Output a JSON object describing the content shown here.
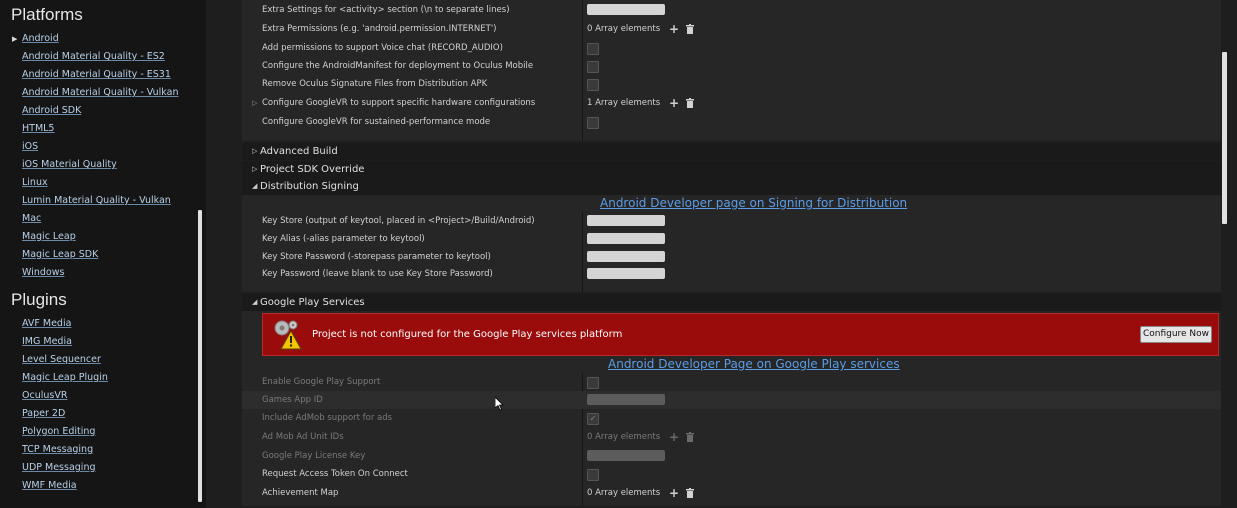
{
  "sidebar": {
    "platforms_title": "Platforms",
    "platforms": [
      "Android",
      "Android Material Quality - ES2",
      "Android Material Quality - ES31",
      "Android Material Quality - Vulkan",
      "Android SDK",
      "HTML5",
      "iOS",
      "iOS Material Quality",
      "Linux",
      "Lumin Material Quality - Vulkan",
      "Mac",
      "Magic Leap",
      "Magic Leap SDK",
      "Windows"
    ],
    "plugins_title": "Plugins",
    "plugins": [
      "AVF Media",
      "IMG Media",
      "Level Sequencer",
      "Magic Leap Plugin",
      "OculusVR",
      "Paper 2D",
      "Polygon Editing",
      "TCP Messaging",
      "UDP Messaging",
      "WMF Media"
    ]
  },
  "top_rows": {
    "extra_settings": "Extra Settings for <activity> section (\\n to separate lines)",
    "extra_permissions": "Extra Permissions (e.g. 'android.permission.INTERNET')",
    "extra_permissions_value": "0 Array elements",
    "voice_chat": "Add permissions to support Voice chat (RECORD_AUDIO)",
    "oculus_mobile": "Configure the AndroidManifest for deployment to Oculus Mobile",
    "remove_oculus": "Remove Oculus Signature Files from Distribution APK",
    "googlevr_hw": "Configure GoogleVR to support specific hardware configurations",
    "googlevr_hw_value": "1 Array elements",
    "googlevr_perf": "Configure GoogleVR for sustained-performance mode"
  },
  "sections": {
    "advanced_build": "Advanced Build",
    "project_sdk_override": "Project SDK Override",
    "distribution_signing": "Distribution Signing",
    "google_play_services": "Google Play Services"
  },
  "signing": {
    "link": "Android Developer page on Signing for Distribution",
    "key_store": "Key Store (output of keytool, placed in <Project>/Build/Android)",
    "key_alias": "Key Alias (-alias parameter to keytool)",
    "key_store_password": "Key Store Password (-storepass parameter to keytool)",
    "key_password": "Key Password (leave blank to use Key Store Password)"
  },
  "google_play": {
    "warning": "Project is not configured for the Google Play services platform",
    "configure_button": "Configure Now",
    "link": "Android Developer Page on Google Play services",
    "enable_support": "Enable Google Play Support",
    "games_app_id": "Games App ID",
    "admob": "Include AdMob support for ads",
    "admob_checked": true,
    "ad_unit_ids": "Ad Mob Ad Unit IDs",
    "ad_unit_ids_value": "0 Array elements",
    "license_key": "Google Play License Key",
    "request_token": "Request Access Token On Connect",
    "achievement_map": "Achievement Map",
    "achievement_map_value": "0 Array elements"
  },
  "icons": {
    "plus": "+",
    "checkmark": "✓",
    "expand_collapsed": "▷",
    "section_expanded": "◢",
    "section_collapsed": "▷",
    "sidebar_expand": "▶"
  },
  "colors": {
    "link": "#5b9ce6",
    "warning_bg": "#9a0c0c"
  }
}
